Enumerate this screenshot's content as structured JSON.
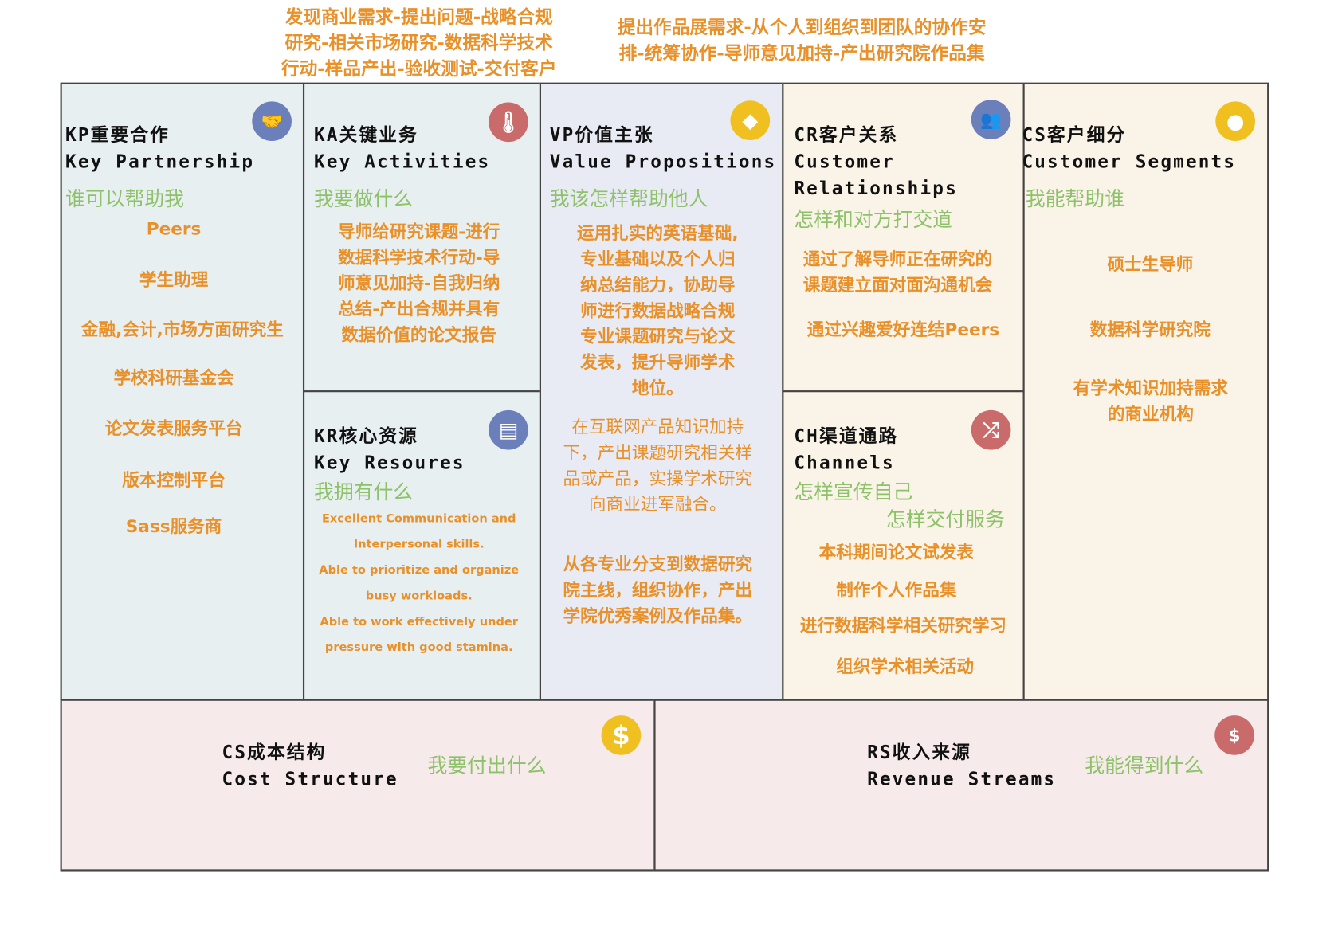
{
  "top_notes": {
    "left": [
      "发现商业需求-提出问题-战略合规",
      "研究-相关市场研究-数据科学技术",
      "行动-样品产出-验收测试-交付客户"
    ],
    "right": [
      "提出作品展需求-从个人到组织到团队的协作安",
      "排-统筹协作-导师意见加持-产出研究院作品集"
    ]
  },
  "kp": {
    "title": "KP重要合作",
    "subtitle": "Key Partnership",
    "question": "谁可以帮助我",
    "items": [
      "Peers",
      "学生助理",
      "金融,会计,市场方面研究生",
      "学校科研基金会",
      "论文发表服务平台",
      "版本控制平台",
      "Sass服务商"
    ],
    "icon": "handshake-icon"
  },
  "ka": {
    "title": "KA关键业务",
    "subtitle": "Key Activities",
    "question": "我要做什么",
    "lines": [
      "导师给研究课题-进行",
      "数据科学技术行动-导",
      "师意见加持-自我归纳",
      "总结-产出合规并具有",
      "数据价值的论文报告"
    ],
    "icon": "thermometer-icon"
  },
  "kr": {
    "title": "KR核心资源",
    "subtitle": "Key Resoures",
    "question": "我拥有什么",
    "lines": [
      "Excellent Communication and",
      "Interpersonal skills.",
      "Able to prioritize and organize",
      "busy workloads.",
      "Able to work effectively under",
      "pressure with good stamina."
    ],
    "icon": "document-icon"
  },
  "vp": {
    "title": "VP价值主张",
    "subtitle": "Value Propositions",
    "question": "我该怎样帮助他人",
    "p1": [
      "运用扎实的英语基础,",
      "专业基础以及个人归",
      "纳总结能力，协助导",
      "师进行数据战略合规",
      "专业课题研究与论文",
      "发表，提升导师学术",
      "地位。"
    ],
    "p2": [
      "在互联网产品知识加持",
      "下，产出课题研究相关样",
      "品或产品，实操学术研究",
      "向商业进军融合。"
    ],
    "p3": [
      "从各专业分支到数据研究",
      "院主线，组织协作，产出",
      "学院优秀案例及作品集。"
    ],
    "icon": "diamond-icon"
  },
  "cr": {
    "title": "CR客户关系",
    "subtitle1": "Customer",
    "subtitle2": "Relationships",
    "question": "怎样和对方打交道",
    "lines": [
      "通过了解导师正在研究的",
      "课题建立面对面沟通机会"
    ],
    "line2": "通过兴趣爱好连结Peers",
    "icon": "people-icon"
  },
  "ch": {
    "title": "CH渠道通路",
    "subtitle": "Channels",
    "question1": "怎样宣传自己",
    "question2": "怎样交付服务",
    "items": [
      "本科期间论文试发表",
      "制作个人作品集",
      "进行数据科学相关研究学习",
      "组织学术相关活动"
    ],
    "icon": "shuffle-icon"
  },
  "cs": {
    "title": "CS客户细分",
    "subtitle": "Customer Segments",
    "question": "我能帮助谁",
    "items": [
      "硕士生导师",
      "数据科学研究院"
    ],
    "last": [
      "有学术知识加持需求",
      "的商业机构"
    ],
    "icon": "person-icon"
  },
  "cost": {
    "title": "CS成本结构",
    "subtitle": "Cost Structure",
    "question": "我要付出什么",
    "icon": "dollar-icon",
    "icon_glyph": "$"
  },
  "revenue": {
    "title": "RS收入来源",
    "subtitle": "Revenue Streams",
    "question": "我能得到什么",
    "icon": "money-bag-icon",
    "icon_glyph": "$"
  },
  "colors": {
    "orange": "#e8912a",
    "green": "#8dc26a",
    "blue_icon": "#6b7fba",
    "red_icon": "#c96b6b",
    "yellow_icon": "#f0c020"
  }
}
